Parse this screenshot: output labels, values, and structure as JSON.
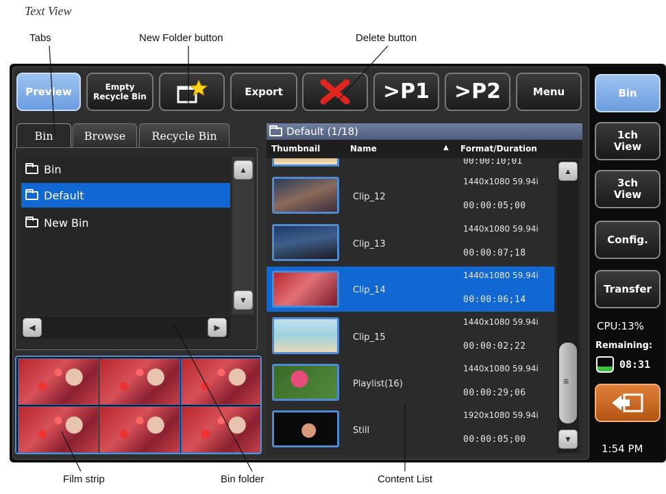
{
  "heading": "Text View",
  "callouts": {
    "tabs": "Tabs",
    "new_folder": "New Folder button",
    "delete": "Delete button",
    "film_strip": "Film strip",
    "bin_folder": "Bin folder",
    "content_list": "Content List"
  },
  "toolbar": {
    "preview": "Preview",
    "empty_recycle_line1": "Empty",
    "empty_recycle_line2": "Recycle Bin",
    "export": "Export",
    "p1": ">P1",
    "p2": ">P2",
    "menu": "Menu"
  },
  "tabs": [
    "Bin",
    "Browse",
    "Recycle Bin"
  ],
  "bins": [
    {
      "label": "Bin",
      "selected": false
    },
    {
      "label": "Default",
      "selected": true
    },
    {
      "label": "New Bin",
      "selected": false
    }
  ],
  "content": {
    "header": "Default (1/18)",
    "columns": [
      "Thumbnail",
      "Name",
      "Format/Duration"
    ],
    "partial_duration": "00:00:10;01",
    "rows": [
      {
        "name": "Clip_12",
        "format": "1440x1080 59.94i",
        "duration": "00:00:05;00",
        "selected": false
      },
      {
        "name": "Clip_13",
        "format": "1440x1080 59.94i",
        "duration": "00:00:07;18",
        "selected": false
      },
      {
        "name": "Clip_14",
        "format": "1440x1080 59.94i",
        "duration": "00:00:06;14",
        "selected": true
      },
      {
        "name": "Clip_15",
        "format": "1440x1080 59.94i",
        "duration": "00:00:02;22",
        "selected": false
      },
      {
        "name": "Playlist(16)",
        "format": "1440x1080 59.94i",
        "duration": "00:00:29;06",
        "selected": false
      },
      {
        "name": "Still",
        "format": "1920x1080 59.94i",
        "duration": "00:00:05;00",
        "selected": false
      }
    ]
  },
  "sidebar": {
    "bin": "Bin",
    "view1_line1": "1ch",
    "view1_line2": "View",
    "view3_line1": "3ch",
    "view3_line2": "View",
    "config": "Config.",
    "transfer": "Transfer",
    "cpu": "CPU:13%",
    "remaining_label": "Remaining:",
    "remaining_value": "08:31",
    "time": "1:54 PM"
  },
  "colors": {
    "accent_blue": "#1268d3",
    "active_button": "#7fb0ea",
    "delete_red": "#e0241e",
    "star_yellow": "#ffd21c"
  }
}
